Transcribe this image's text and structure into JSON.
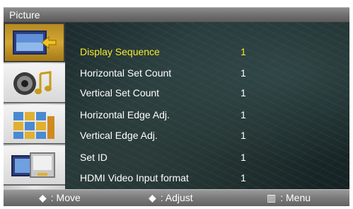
{
  "window": {
    "title": "Picture"
  },
  "sidebar": {
    "tabs": [
      {
        "icon": "picture-icon",
        "selected": true
      },
      {
        "icon": "sound-icon",
        "selected": false
      },
      {
        "icon": "setup-icon",
        "selected": false
      },
      {
        "icon": "multi-control-icon",
        "selected": false
      }
    ]
  },
  "menu": {
    "items": [
      {
        "label": "Display Sequence",
        "value": "1",
        "active": true
      },
      {
        "label": "Horizontal Set Count",
        "value": "1",
        "active": false
      },
      {
        "label": "Vertical Set Count",
        "value": "1",
        "active": false
      },
      {
        "label": "Horizontal Edge Adj.",
        "value": "1",
        "active": false
      },
      {
        "label": "Vertical Edge Adj.",
        "value": "1",
        "active": false
      },
      {
        "label": "Set ID",
        "value": "1",
        "active": false
      },
      {
        "label": "HDMI Video Input format",
        "value": "1",
        "active": false
      }
    ]
  },
  "footer": {
    "move": {
      "glyph": "◆",
      "label": ": Move"
    },
    "adjust": {
      "glyph": "◆",
      "label": ": Adjust"
    },
    "menu": {
      "glyph": "▥",
      "label": ": Menu"
    }
  },
  "colors": {
    "highlight": "#f7ea2a",
    "text": "#ffffff",
    "tab_selected": "#d6a632"
  }
}
